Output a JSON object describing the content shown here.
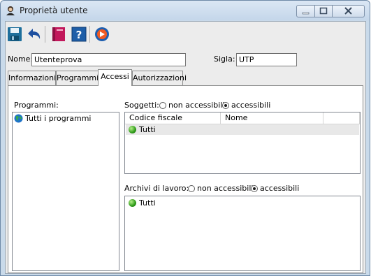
{
  "window": {
    "title": "Proprietà utente"
  },
  "form": {
    "nome_label": "Nome:",
    "nome_value": "Utenteprova",
    "sigla_label": "Sigla:",
    "sigla_value": "UTP"
  },
  "tabs": [
    {
      "label": "Informazioni"
    },
    {
      "label": "Programmi"
    },
    {
      "label": "Accessi"
    },
    {
      "label": "Autorizzazioni"
    }
  ],
  "accessi": {
    "programmi_label": "Programmi:",
    "programmi_items": [
      {
        "label": "Tutti i programmi"
      }
    ],
    "soggetti_label": "Soggetti:",
    "non_accessibili": "non accessibili",
    "accessibili": "accessibili",
    "soggetti_columns": [
      "Codice fiscale",
      "Nome"
    ],
    "soggetti_items": [
      {
        "label": "Tutti"
      }
    ],
    "archivi_label": "Archivi di lavoro:",
    "archivi_items": [
      {
        "label": "Tutti"
      }
    ],
    "soggetti_selected": "accessibili",
    "archivi_selected": "accessibili"
  },
  "icons": [
    "user-title-icon",
    "save-icon",
    "undo-icon",
    "book-icon",
    "help-icon",
    "exit-icon",
    "globe-icon",
    "green-ball-icon"
  ]
}
